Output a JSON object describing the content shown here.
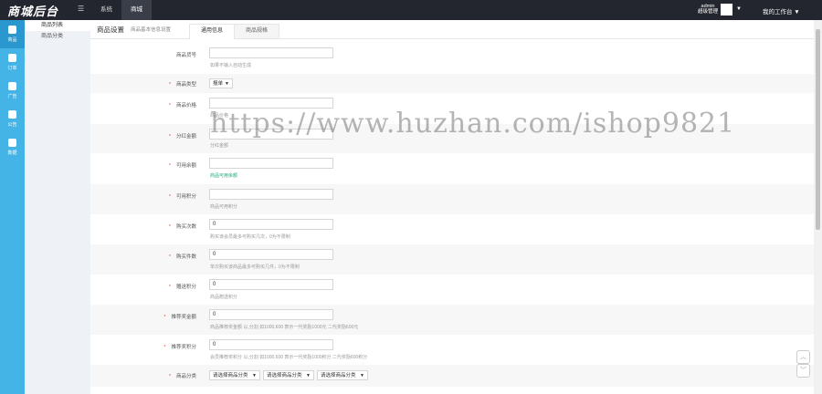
{
  "header": {
    "logo": "商城后台",
    "nav": [
      "系统",
      "商城"
    ],
    "user_name": "admin",
    "user_role": "超级管理",
    "workbench": "我的工作台"
  },
  "leftnav": [
    {
      "label": "商品",
      "icon": "goods-icon"
    },
    {
      "label": "订单",
      "icon": "order-icon"
    },
    {
      "label": "广告",
      "icon": "ad-icon"
    },
    {
      "label": "公告",
      "icon": "notice-icon"
    },
    {
      "label": "数据",
      "icon": "data-icon"
    }
  ],
  "subnav": [
    "商品列表",
    "商品分类"
  ],
  "page": {
    "title": "商品设置",
    "subtitle": "商品基本信息设置",
    "tabs": [
      "通用信息",
      "商品规格"
    ]
  },
  "form": {
    "sku_label": "商品货号",
    "sku_hint": "如果不输入自动生成",
    "type_label": "商品类型",
    "type_value": "报单",
    "price_label": "商品价格",
    "price_hint": "商品价格",
    "dividend_label": "分红金额",
    "dividend_hint": "分红金额",
    "balance_label": "可用余额",
    "balance_hint": "商品可用余额",
    "points_label": "可用积分",
    "points_hint": "商品可用积分",
    "limit_label": "购买次数",
    "limit_value": "0",
    "limit_hint": "购买该会员最多可购买几次，0为不限制",
    "qty_label": "购买件数",
    "qty_value": "0",
    "qty_hint": "单次购买该商品最多可购买几件，0为不限制",
    "gift_label": "赠送积分",
    "gift_value": "0",
    "gift_hint": "商品赠送积分",
    "recommend_label": "推荐奖金额",
    "recommend_value": "0",
    "recommend_hint": "商品推荐奖金额 以,分割 如1000,600 表示一代奖励1000元 二代奖励600元",
    "recommend_points_label": "推荐奖积分",
    "recommend_points_value": "0",
    "recommend_points_hint": "会员推荐奖积分 以,分割 如1000,600 表示一代奖励1000积分 二代奖励600积分",
    "category_label": "商品分类",
    "category_selects": [
      "请选择商品分类",
      "请选择商品分类",
      "请选择商品分类"
    ]
  },
  "watermark": "https://www.huzhan.com/ishop9821"
}
